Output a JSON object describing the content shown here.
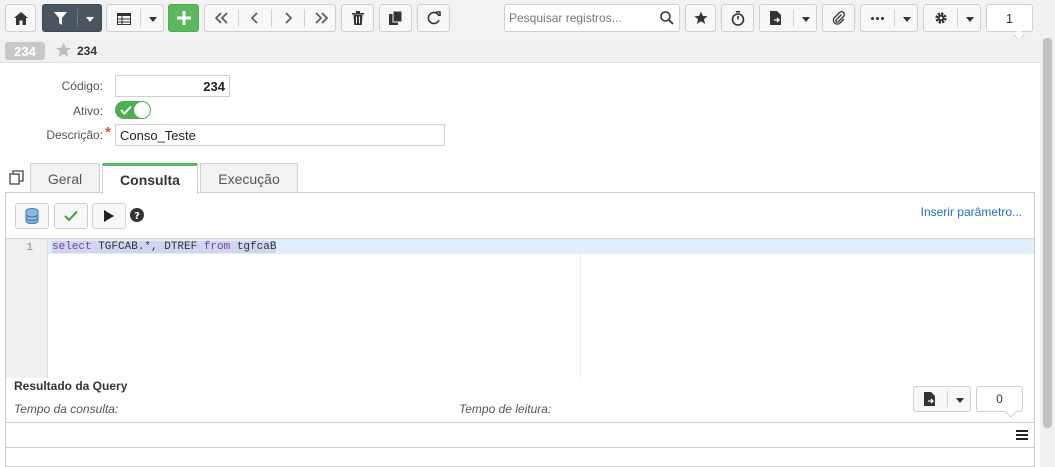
{
  "toolbar": {
    "search_placeholder": "Pesquisar registros...",
    "page_number": "1"
  },
  "record": {
    "id_badge": "234",
    "title": "234"
  },
  "form": {
    "codigo_label": "Código:",
    "codigo_value": "234",
    "ativo_label": "Ativo:",
    "ativo_value": "on",
    "descricao_label": "Descrição:",
    "descricao_required_mark": "*",
    "descricao_value": "Conso_Teste"
  },
  "tabs": [
    {
      "label": "Geral",
      "active": false
    },
    {
      "label": "Consulta",
      "active": true
    },
    {
      "label": "Execução",
      "active": false
    }
  ],
  "query_panel": {
    "insert_param_link": "Inserir parâmetro...",
    "editor": {
      "line_number": "1",
      "kw_select": "select",
      "code_mid": " TGFCAB.*, DTREF ",
      "kw_from": "from",
      "code_end": " tgfcaB"
    }
  },
  "result": {
    "title": "Resultado da Query",
    "query_time_label": "Tempo da consulta:",
    "read_time_label": "Tempo de leitura:",
    "row_count": "0"
  },
  "colors": {
    "accent_green": "#5cb85c",
    "dark_button": "#4a5560",
    "link_blue": "#2a6ebb"
  }
}
